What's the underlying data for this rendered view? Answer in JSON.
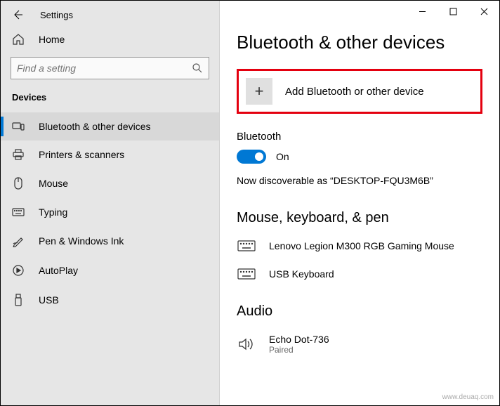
{
  "window": {
    "app_title": "Settings"
  },
  "sidebar": {
    "home_label": "Home",
    "search_placeholder": "Find a setting",
    "section_label": "Devices",
    "items": [
      {
        "label": "Bluetooth & other devices"
      },
      {
        "label": "Printers & scanners"
      },
      {
        "label": "Mouse"
      },
      {
        "label": "Typing"
      },
      {
        "label": "Pen & Windows Ink"
      },
      {
        "label": "AutoPlay"
      },
      {
        "label": "USB"
      }
    ]
  },
  "main": {
    "title": "Bluetooth & other devices",
    "add_device_label": "Add Bluetooth or other device",
    "bluetooth_section_label": "Bluetooth",
    "bluetooth_toggle_state": "On",
    "discoverable_text": "Now discoverable as “DESKTOP-FQU3M6B”",
    "sections": [
      {
        "heading": "Mouse, keyboard, & pen",
        "devices": [
          {
            "name": "Lenovo Legion M300 RGB Gaming Mouse",
            "icon": "keyboard"
          },
          {
            "name": "USB Keyboard",
            "icon": "keyboard"
          }
        ]
      },
      {
        "heading": "Audio",
        "devices": [
          {
            "name": "Echo Dot-736",
            "sub": "Paired",
            "icon": "speaker"
          }
        ]
      }
    ]
  },
  "watermark": "www.deuaq.com"
}
